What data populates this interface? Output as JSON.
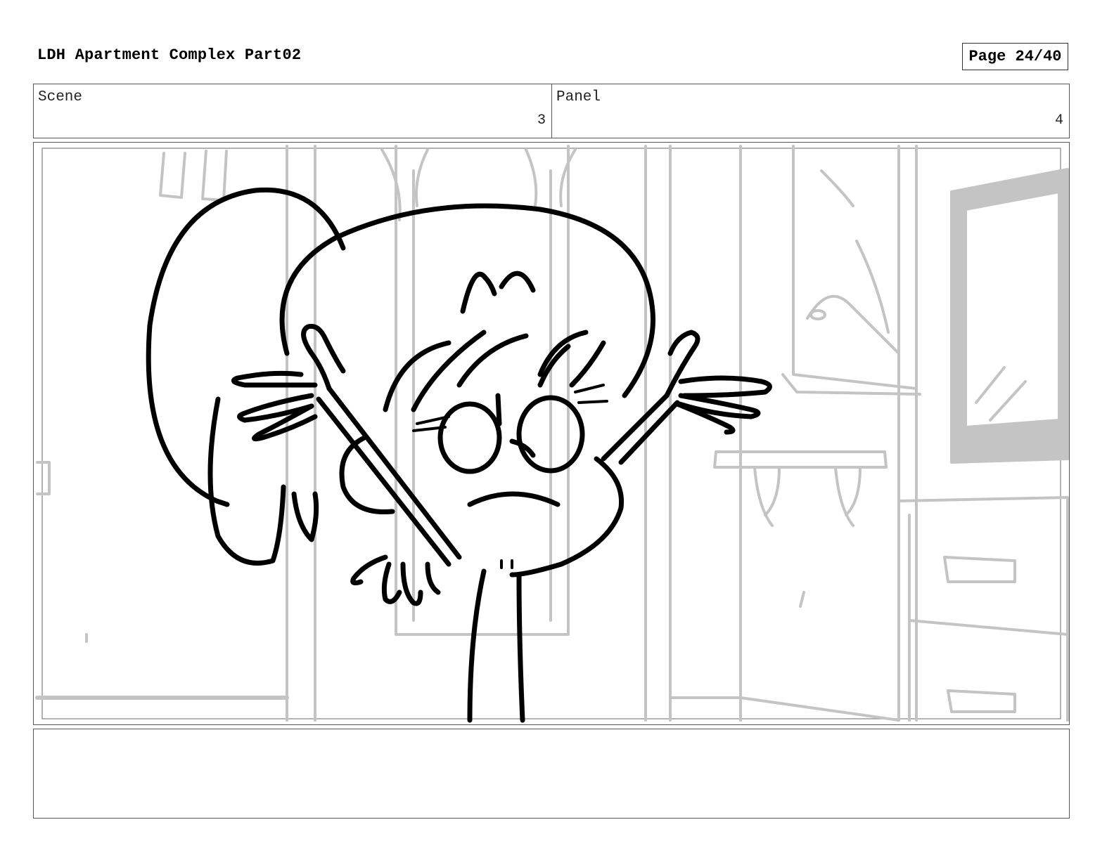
{
  "header": {
    "title": "LDH Apartment Complex Part02",
    "page": "Page 24/40"
  },
  "scene": {
    "label": "Scene",
    "value": "3"
  },
  "panel": {
    "label": "Panel",
    "value": "4"
  },
  "notes": {
    "text": ""
  }
}
